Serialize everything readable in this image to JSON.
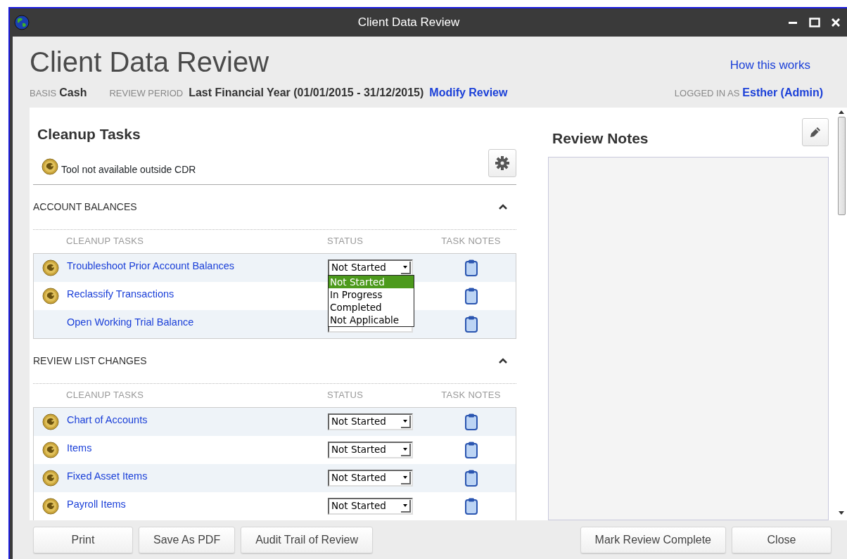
{
  "window": {
    "title": "Client Data Review"
  },
  "header": {
    "title": "Client Data Review",
    "help_link": "How this works",
    "basis_label": "BASIS",
    "basis": "Cash",
    "period_label": "REVIEW PERIOD",
    "period": "Last Financial Year (01/01/2015 - 31/12/2015)",
    "modify_link": "Modify Review",
    "logged_label": "LOGGED IN AS",
    "user": "Esther (Admin)"
  },
  "cleanup": {
    "title": "Cleanup Tasks",
    "legend": "Tool not available outside CDR",
    "sections": [
      {
        "title": "ACCOUNT BALANCES",
        "expanded": true,
        "columns": [
          "CLEANUP TASKS",
          "STATUS",
          "TASK NOTES"
        ],
        "tasks": [
          {
            "name": "Troubleshoot Prior Account Balances",
            "tool_icon": true,
            "status": "Not Started",
            "dropdown_open": true,
            "options": [
              {
                "label": "Not Started",
                "selected": true
              },
              {
                "label": "In Progress",
                "selected": false
              },
              {
                "label": "Completed",
                "selected": false
              },
              {
                "label": "Not Applicable",
                "selected": false
              }
            ]
          },
          {
            "name": "Reclassify Transactions",
            "tool_icon": true
          },
          {
            "name": "Open Working Trial Balance",
            "tool_icon": false
          }
        ]
      },
      {
        "title": "REVIEW LIST CHANGES",
        "expanded": true,
        "columns": [
          "CLEANUP TASKS",
          "STATUS",
          "TASK NOTES"
        ],
        "tasks": [
          {
            "name": "Chart of Accounts",
            "tool_icon": true,
            "status": "Not Started"
          },
          {
            "name": "Items",
            "tool_icon": true,
            "status": "Not Started"
          },
          {
            "name": "Fixed Asset Items",
            "tool_icon": true,
            "status": "Not Started"
          },
          {
            "name": "Payroll Items",
            "tool_icon": true,
            "status": "Not Started"
          }
        ]
      }
    ]
  },
  "notes": {
    "title": "Review Notes"
  },
  "buttons_left": [
    "Print",
    "Save As PDF",
    "Audit Trail of Review"
  ],
  "buttons_right": [
    "Mark Review Complete",
    "Close"
  ]
}
